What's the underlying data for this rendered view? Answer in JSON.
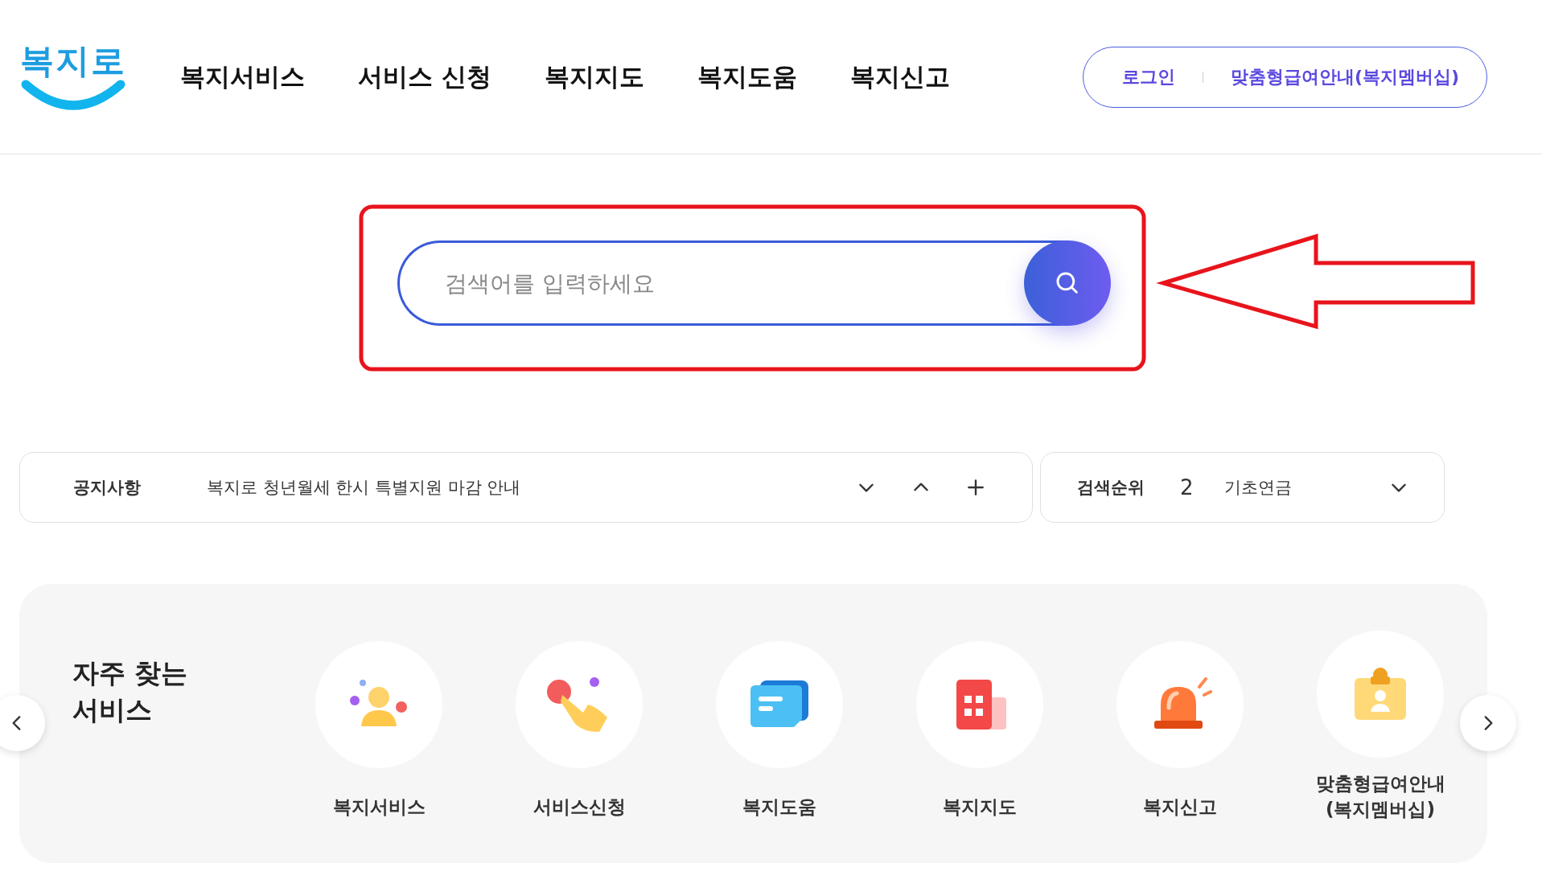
{
  "logo": {
    "text": "복지로"
  },
  "nav": [
    {
      "label": "복지서비스"
    },
    {
      "label": "서비스 신청"
    },
    {
      "label": "복지지도"
    },
    {
      "label": "복지도움"
    },
    {
      "label": "복지신고"
    }
  ],
  "account": {
    "login": "로그인",
    "membership": "맞춤형급여안내(복지멤버십)"
  },
  "search": {
    "placeholder": "검색어를 입력하세요"
  },
  "notice": {
    "label": "공지사항",
    "text": "복지로 청년월세 한시 특별지원 마감 안내"
  },
  "ranking": {
    "label": "검색순위",
    "rank": "2",
    "keyword": "기초연금"
  },
  "services": {
    "title": "자주 찾는 서비스",
    "items": [
      {
        "label": "복지서비스",
        "kind": "person"
      },
      {
        "label": "서비스신청",
        "kind": "hand"
      },
      {
        "label": "복지도움",
        "kind": "chat"
      },
      {
        "label": "복지지도",
        "kind": "building"
      },
      {
        "label": "복지신고",
        "kind": "siren"
      },
      {
        "label": "맞춤형급여안내(복지멤버십)",
        "kind": "badge"
      }
    ]
  }
}
